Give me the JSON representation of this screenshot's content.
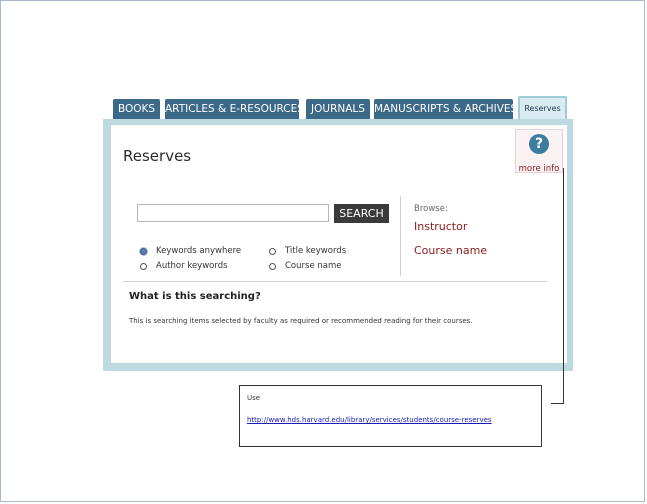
{
  "tabs": [
    {
      "label": "BOOKS"
    },
    {
      "label": "ARTICLES & E-RESOURCES"
    },
    {
      "label": "JOURNALS"
    },
    {
      "label": "MANUSCRIPTS & ARCHIVES"
    },
    {
      "label": "Reserves"
    }
  ],
  "panel": {
    "title": "Reserves",
    "help_label": "more info",
    "help_icon": "question-icon",
    "search_value": "",
    "search_button": "SEARCH",
    "browse": {
      "heading": "Browse:",
      "links": [
        "Instructor",
        "Course name"
      ]
    },
    "options": [
      {
        "label": "Keywords anywhere",
        "selected": true
      },
      {
        "label": "Title keywords",
        "selected": false
      },
      {
        "label": "Author keywords",
        "selected": false
      },
      {
        "label": "Course name",
        "selected": false
      }
    ],
    "question": "What is this searching?",
    "answer": "This is searching items selected by faculty as required or recommended reading for their courses."
  },
  "note": {
    "label": "Use",
    "link": "http://www.hds.harvard.edu/library/services/students/course-reserves"
  },
  "colors": {
    "tab": "#3d6989",
    "panel_border": "#bfd9e1",
    "link": "#8a1a1a"
  }
}
